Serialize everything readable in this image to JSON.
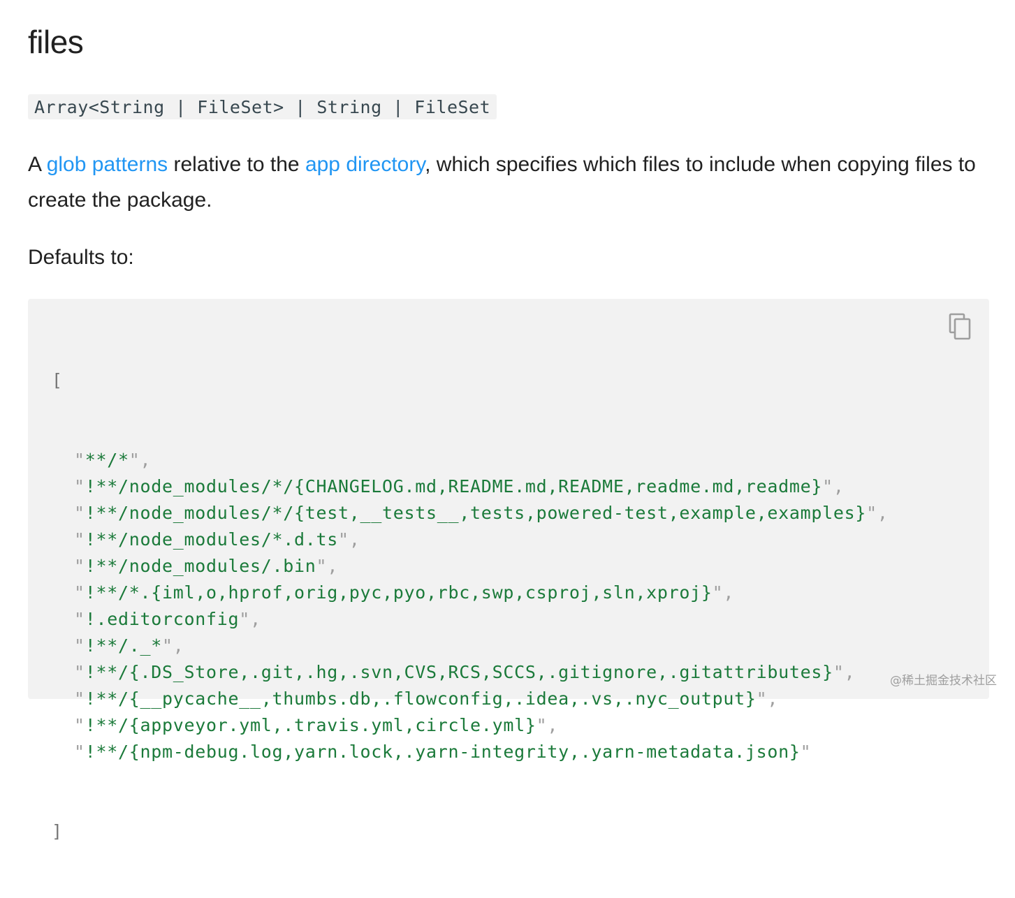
{
  "heading": {
    "title": "files"
  },
  "type_signature": "Array<String | FileSet> | String | FileSet",
  "description": {
    "prefix": "A ",
    "link1": "glob patterns",
    "middle": " relative to the ",
    "link2": "app directory",
    "suffix": ", which specifies which files to include when copying files to create the package."
  },
  "defaults_label": "Defaults to:",
  "code": {
    "open_bracket": "[",
    "close_bracket": "]",
    "lines": [
      "**/*",
      "!**/node_modules/*/{CHANGELOG.md,README.md,README,readme.md,readme}",
      "!**/node_modules/*/{test,__tests__,tests,powered-test,example,examples}",
      "!**/node_modules/*.d.ts",
      "!**/node_modules/.bin",
      "!**/*.{iml,o,hprof,orig,pyc,pyo,rbc,swp,csproj,sln,xproj}",
      "!.editorconfig",
      "!**/._*",
      "!**/{.DS_Store,.git,.hg,.svn,CVS,RCS,SCCS,.gitignore,.gitattributes}",
      "!**/{__pycache__,thumbs.db,.flowconfig,.idea,.vs,.nyc_output}",
      "!**/{appveyor.yml,.travis.yml,circle.yml}",
      "!**/{npm-debug.log,yarn.lock,.yarn-integrity,.yarn-metadata.json}"
    ],
    "copy_icon": "copy-icon"
  },
  "watermark": "@稀土掘金技术社区",
  "colors": {
    "link": "#2196f3",
    "code_string": "#1b7a3a",
    "code_bg": "#f2f2f2"
  }
}
